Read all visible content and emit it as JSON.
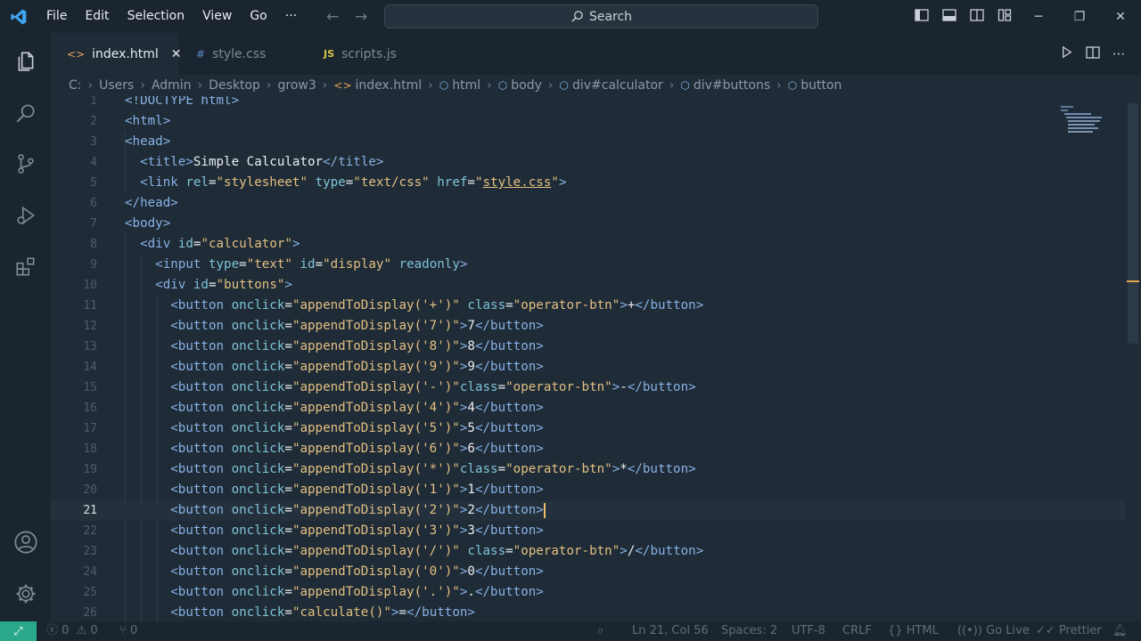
{
  "menu": {
    "file": "File",
    "edit": "Edit",
    "selection": "Selection",
    "view": "View",
    "go": "Go",
    "more": "···"
  },
  "search": {
    "label": "Search"
  },
  "tabs": [
    {
      "label": "index.html",
      "icon": "<>",
      "close": "✕"
    },
    {
      "label": "style.css",
      "icon": "#"
    },
    {
      "label": "scripts.js",
      "icon": "JS"
    }
  ],
  "breadcrumb": {
    "drive": "C:",
    "users": "Users",
    "admin": "Admin",
    "desktop": "Desktop",
    "folder": "grow3",
    "file": "index.html",
    "html": "html",
    "body": "body",
    "calc": "div#calculator",
    "buttons": "div#buttons",
    "button": "button"
  },
  "editor": {
    "current_line": 21,
    "lines": [
      {
        "n": "1",
        "tokens": [
          [
            "tag",
            "<!DOCTYPE"
          ],
          [
            "txt",
            " "
          ],
          [
            "tag",
            "html"
          ],
          [
            "tag",
            ">"
          ]
        ]
      },
      {
        "n": "2",
        "tokens": [
          [
            "tag",
            "<html>"
          ]
        ]
      },
      {
        "n": "3",
        "tokens": [
          [
            "tag",
            "<head>"
          ]
        ]
      },
      {
        "n": "4",
        "tokens": [
          [
            "txt",
            "  "
          ],
          [
            "tag",
            "<title>"
          ],
          [
            "txt",
            "Simple Calculator"
          ],
          [
            "tag",
            "</title>"
          ]
        ]
      },
      {
        "n": "5",
        "tokens": [
          [
            "txt",
            "  "
          ],
          [
            "tag",
            "<link "
          ],
          [
            "attr",
            "rel"
          ],
          [
            "txt",
            "="
          ],
          [
            "str",
            "\"stylesheet\""
          ],
          [
            "txt",
            " "
          ],
          [
            "attr",
            "type"
          ],
          [
            "txt",
            "="
          ],
          [
            "str",
            "\"text/css\""
          ],
          [
            "txt",
            " "
          ],
          [
            "attr",
            "href"
          ],
          [
            "txt",
            "="
          ],
          [
            "str",
            "\""
          ],
          [
            "link",
            "style.css"
          ],
          [
            "str",
            "\""
          ],
          [
            "tag",
            ">"
          ]
        ]
      },
      {
        "n": "6",
        "tokens": [
          [
            "tag",
            "</head>"
          ]
        ]
      },
      {
        "n": "7",
        "tokens": [
          [
            "tag",
            "<body>"
          ]
        ]
      },
      {
        "n": "8",
        "tokens": [
          [
            "txt",
            "  "
          ],
          [
            "tag",
            "<div "
          ],
          [
            "attr",
            "id"
          ],
          [
            "txt",
            "="
          ],
          [
            "str",
            "\"calculator\""
          ],
          [
            "tag",
            ">"
          ]
        ]
      },
      {
        "n": "9",
        "tokens": [
          [
            "txt",
            "    "
          ],
          [
            "tag",
            "<input "
          ],
          [
            "attr",
            "type"
          ],
          [
            "txt",
            "="
          ],
          [
            "str",
            "\"text\""
          ],
          [
            "txt",
            " "
          ],
          [
            "attr",
            "id"
          ],
          [
            "txt",
            "="
          ],
          [
            "str",
            "\"display\""
          ],
          [
            "txt",
            " "
          ],
          [
            "attr",
            "readonly"
          ],
          [
            "tag",
            ">"
          ]
        ]
      },
      {
        "n": "10",
        "tokens": [
          [
            "txt",
            "    "
          ],
          [
            "tag",
            "<div "
          ],
          [
            "attr",
            "id"
          ],
          [
            "txt",
            "="
          ],
          [
            "str",
            "\"buttons\""
          ],
          [
            "tag",
            ">"
          ]
        ]
      },
      {
        "n": "11",
        "tokens": [
          [
            "txt",
            "      "
          ],
          [
            "tag",
            "<button "
          ],
          [
            "attr",
            "onclick"
          ],
          [
            "txt",
            "="
          ],
          [
            "str",
            "\"appendToDisplay('+')\""
          ],
          [
            "txt",
            " "
          ],
          [
            "attr",
            "class"
          ],
          [
            "txt",
            "="
          ],
          [
            "str",
            "\"operator-btn\""
          ],
          [
            "tag",
            ">"
          ],
          [
            "txt",
            "+"
          ],
          [
            "tag",
            "</button>"
          ]
        ]
      },
      {
        "n": "12",
        "tokens": [
          [
            "txt",
            "      "
          ],
          [
            "tag",
            "<button "
          ],
          [
            "attr",
            "onclick"
          ],
          [
            "txt",
            "="
          ],
          [
            "str",
            "\"appendToDisplay('7')\""
          ],
          [
            "tag",
            ">"
          ],
          [
            "txt",
            "7"
          ],
          [
            "tag",
            "</button>"
          ]
        ]
      },
      {
        "n": "13",
        "tokens": [
          [
            "txt",
            "      "
          ],
          [
            "tag",
            "<button "
          ],
          [
            "attr",
            "onclick"
          ],
          [
            "txt",
            "="
          ],
          [
            "str",
            "\"appendToDisplay('8')\""
          ],
          [
            "tag",
            ">"
          ],
          [
            "txt",
            "8"
          ],
          [
            "tag",
            "</button>"
          ]
        ]
      },
      {
        "n": "14",
        "tokens": [
          [
            "txt",
            "      "
          ],
          [
            "tag",
            "<button "
          ],
          [
            "attr",
            "onclick"
          ],
          [
            "txt",
            "="
          ],
          [
            "str",
            "\"appendToDisplay('9')\""
          ],
          [
            "tag",
            ">"
          ],
          [
            "txt",
            "9"
          ],
          [
            "tag",
            "</button>"
          ]
        ]
      },
      {
        "n": "15",
        "tokens": [
          [
            "txt",
            "      "
          ],
          [
            "tag",
            "<button "
          ],
          [
            "attr",
            "onclick"
          ],
          [
            "txt",
            "="
          ],
          [
            "str",
            "\"appendToDisplay('-')\""
          ],
          [
            "attr",
            "class"
          ],
          [
            "txt",
            "="
          ],
          [
            "str",
            "\"operator-btn\""
          ],
          [
            "tag",
            ">"
          ],
          [
            "txt",
            "-"
          ],
          [
            "tag",
            "</button>"
          ]
        ]
      },
      {
        "n": "16",
        "tokens": [
          [
            "txt",
            "      "
          ],
          [
            "tag",
            "<button "
          ],
          [
            "attr",
            "onclick"
          ],
          [
            "txt",
            "="
          ],
          [
            "str",
            "\"appendToDisplay('4')\""
          ],
          [
            "tag",
            ">"
          ],
          [
            "txt",
            "4"
          ],
          [
            "tag",
            "</button>"
          ]
        ]
      },
      {
        "n": "17",
        "tokens": [
          [
            "txt",
            "      "
          ],
          [
            "tag",
            "<button "
          ],
          [
            "attr",
            "onclick"
          ],
          [
            "txt",
            "="
          ],
          [
            "str",
            "\"appendToDisplay('5')\""
          ],
          [
            "tag",
            ">"
          ],
          [
            "txt",
            "5"
          ],
          [
            "tag",
            "</button>"
          ]
        ]
      },
      {
        "n": "18",
        "tokens": [
          [
            "txt",
            "      "
          ],
          [
            "tag",
            "<button "
          ],
          [
            "attr",
            "onclick"
          ],
          [
            "txt",
            "="
          ],
          [
            "str",
            "\"appendToDisplay('6')\""
          ],
          [
            "tag",
            ">"
          ],
          [
            "txt",
            "6"
          ],
          [
            "tag",
            "</button>"
          ]
        ]
      },
      {
        "n": "19",
        "tokens": [
          [
            "txt",
            "      "
          ],
          [
            "tag",
            "<button "
          ],
          [
            "attr",
            "onclick"
          ],
          [
            "txt",
            "="
          ],
          [
            "str",
            "\"appendToDisplay('*')\""
          ],
          [
            "attr",
            "class"
          ],
          [
            "txt",
            "="
          ],
          [
            "str",
            "\"operator-btn\""
          ],
          [
            "tag",
            ">"
          ],
          [
            "txt",
            "*"
          ],
          [
            "tag",
            "</button>"
          ]
        ]
      },
      {
        "n": "20",
        "tokens": [
          [
            "txt",
            "      "
          ],
          [
            "tag",
            "<button "
          ],
          [
            "attr",
            "onclick"
          ],
          [
            "txt",
            "="
          ],
          [
            "str",
            "\"appendToDisplay('1')\""
          ],
          [
            "tag",
            ">"
          ],
          [
            "txt",
            "1"
          ],
          [
            "tag",
            "</button>"
          ]
        ]
      },
      {
        "n": "21",
        "tokens": [
          [
            "txt",
            "      "
          ],
          [
            "tag",
            "<button "
          ],
          [
            "attr",
            "onclick"
          ],
          [
            "txt",
            "="
          ],
          [
            "str",
            "\"appendToDisplay('2')\""
          ],
          [
            "tag",
            ">"
          ],
          [
            "txt",
            "2"
          ],
          [
            "tag",
            "</button>"
          ]
        ]
      },
      {
        "n": "22",
        "tokens": [
          [
            "txt",
            "      "
          ],
          [
            "tag",
            "<button "
          ],
          [
            "attr",
            "onclick"
          ],
          [
            "txt",
            "="
          ],
          [
            "str",
            "\"appendToDisplay('3')\""
          ],
          [
            "tag",
            ">"
          ],
          [
            "txt",
            "3"
          ],
          [
            "tag",
            "</button>"
          ]
        ]
      },
      {
        "n": "23",
        "tokens": [
          [
            "txt",
            "      "
          ],
          [
            "tag",
            "<button "
          ],
          [
            "attr",
            "onclick"
          ],
          [
            "txt",
            "="
          ],
          [
            "str",
            "\"appendToDisplay('/')\""
          ],
          [
            "txt",
            " "
          ],
          [
            "attr",
            "class"
          ],
          [
            "txt",
            "="
          ],
          [
            "str",
            "\"operator-btn\""
          ],
          [
            "tag",
            ">"
          ],
          [
            "txt",
            "/"
          ],
          [
            "tag",
            "</button>"
          ]
        ]
      },
      {
        "n": "24",
        "tokens": [
          [
            "txt",
            "      "
          ],
          [
            "tag",
            "<button "
          ],
          [
            "attr",
            "onclick"
          ],
          [
            "txt",
            "="
          ],
          [
            "str",
            "\"appendToDisplay('0')\""
          ],
          [
            "tag",
            ">"
          ],
          [
            "txt",
            "0"
          ],
          [
            "tag",
            "</button>"
          ]
        ]
      },
      {
        "n": "25",
        "tokens": [
          [
            "txt",
            "      "
          ],
          [
            "tag",
            "<button "
          ],
          [
            "attr",
            "onclick"
          ],
          [
            "txt",
            "="
          ],
          [
            "str",
            "\"appendToDisplay('.')\""
          ],
          [
            "tag",
            ">"
          ],
          [
            "txt",
            "."
          ],
          [
            "tag",
            "</button>"
          ]
        ]
      },
      {
        "n": "26",
        "tokens": [
          [
            "txt",
            "      "
          ],
          [
            "tag",
            "<button "
          ],
          [
            "attr",
            "onclick"
          ],
          [
            "txt",
            "="
          ],
          [
            "str",
            "\"calculate()\""
          ],
          [
            "tag",
            ">"
          ],
          [
            "txt",
            "="
          ],
          [
            "tag",
            "</button>"
          ]
        ]
      }
    ]
  },
  "status": {
    "errors": "0",
    "warnings": "0",
    "ports": "0",
    "position": "Ln 21, Col 56",
    "spaces": "Spaces: 2",
    "encoding": "UTF-8",
    "eol": "CRLF",
    "language": "HTML",
    "golive": "Go Live",
    "prettier": "Prettier"
  }
}
